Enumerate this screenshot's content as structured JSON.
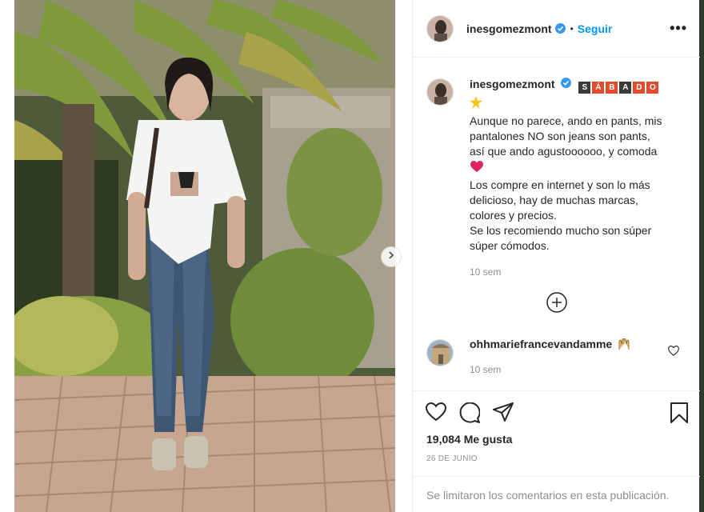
{
  "post": {
    "username": "inesgomezmont",
    "follow_label": "Seguir",
    "separator": "•",
    "more_label": "•••"
  },
  "caption": {
    "username": "inesgomezmont",
    "sabado_letters": [
      "S",
      "Á",
      "B",
      "A",
      "D",
      "O"
    ],
    "lines_a": [
      "Aunque no parece, ando en pants, mis",
      "pantalones NO son jeans son pants,",
      "así que ando agustoooooo, y comoda"
    ],
    "lines_b": [
      "Los compre en internet y son lo más",
      "delicioso, hay de muchas marcas,",
      "colores y precios.",
      "Se los recomiendo mucho son súper",
      "súper cómodos."
    ],
    "time": "10 sem"
  },
  "comment": {
    "username": "ohhmariefrancevandamme",
    "time": "10 sem"
  },
  "actions": {
    "likes": "19,084 Me gusta",
    "date": "26 DE JUNIO",
    "limited_text": "Se limitaron los comentarios en esta publicación."
  },
  "icons": {
    "verified": "verified-badge-icon",
    "like": "heart-icon",
    "comment": "comment-bubble-icon",
    "share": "paper-plane-icon",
    "save": "bookmark-icon",
    "add": "plus-circle-icon",
    "next": "chevron-right-icon"
  },
  "colors": {
    "link": "#0095f6",
    "verified": "#3897f0",
    "muted": "#8e8e8e"
  }
}
